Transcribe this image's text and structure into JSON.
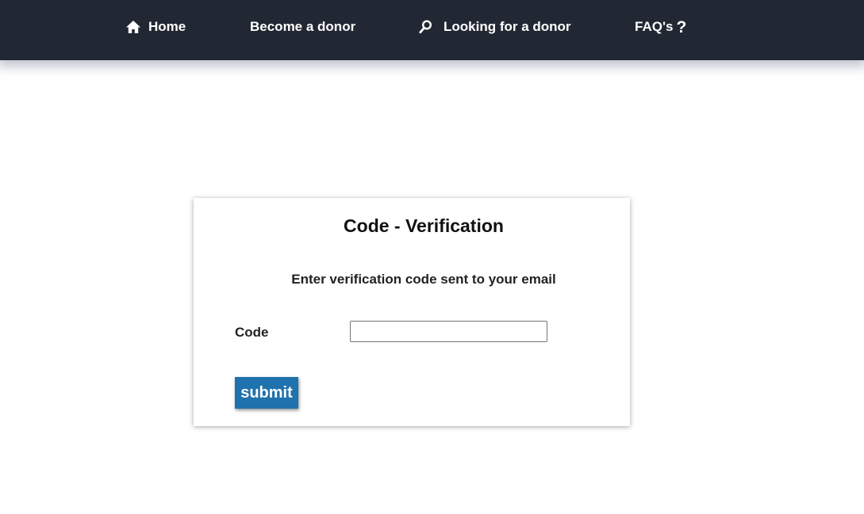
{
  "nav": {
    "items": [
      {
        "label": "Home",
        "icon": "home-icon"
      },
      {
        "label": "Become a donor"
      },
      {
        "label": "Looking for a donor",
        "icon": "search-icon"
      },
      {
        "label": "FAQ's",
        "suffix": "?"
      }
    ]
  },
  "card": {
    "title": "Code - Verification",
    "subtitle": "Enter verification code sent to your email",
    "code_label": "Code",
    "code_value": "",
    "submit_label": "submit"
  },
  "colors": {
    "navbar_bg": "#222833",
    "nav_text": "#ffffff",
    "submit_bg": "#1f72ad"
  }
}
